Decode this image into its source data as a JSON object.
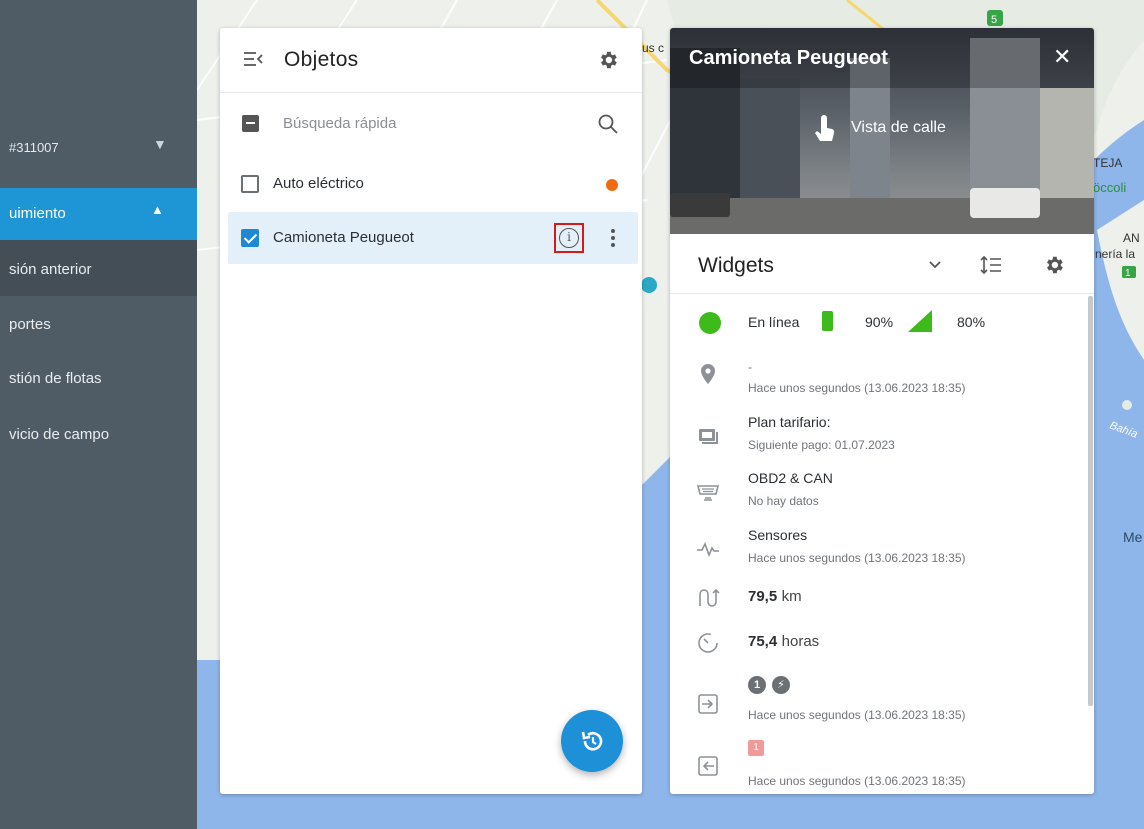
{
  "sidebar": {
    "account_id": "#311007",
    "active_item": "uimiento",
    "sub_item": "sión anterior",
    "items": [
      "portes",
      "stión de flotas",
      "vicio de campo"
    ]
  },
  "map": {
    "labels": [
      "TEJA",
      "öccoli",
      "AN",
      "nería la",
      "Bahía",
      "Me",
      "us c"
    ],
    "road_badges": [
      "5",
      "1"
    ]
  },
  "objects": {
    "title": "Objetos",
    "search_placeholder": "Búsqueda rápida",
    "rows": [
      {
        "label": "Auto eléctrico",
        "checked": false,
        "status_color": "#f06a0f"
      },
      {
        "label": "Camioneta Peugueot",
        "checked": true
      }
    ],
    "info_glyph": "i"
  },
  "details": {
    "title": "Camioneta Peugueot",
    "close_glyph": "✕",
    "street_view_label": "Vista de calle",
    "widgets_title": "Widgets",
    "status": {
      "text": "En línea",
      "battery": "90%",
      "signal": "80%"
    },
    "location": {
      "title": "-",
      "time": "Hace unos segundos (13.06.2023 18:35)"
    },
    "tariff": {
      "title": "Plan tarifario:",
      "sub": "Siguiente pago: 01.07.2023"
    },
    "obd": {
      "title": "OBD2 & CAN",
      "sub": "No hay datos"
    },
    "sensors": {
      "title": "Sensores",
      "sub": "Hace unos segundos (13.06.2023 18:35)"
    },
    "mileage": {
      "value": "79,5",
      "unit": "km"
    },
    "engine_hours": {
      "value": "75,4",
      "unit": "horas"
    },
    "inputs": {
      "badges": [
        "1",
        "⚡"
      ],
      "time": "Hace unos segundos (13.06.2023 18:35)"
    },
    "outputs": {
      "badge": "1",
      "time": "Hace unos segundos (13.06.2023 18:35)"
    }
  },
  "colors": {
    "accent": "#1e96d6",
    "online": "#3cbb1a",
    "sidebar": "#4f5b65",
    "alert": "#f06a0f"
  }
}
